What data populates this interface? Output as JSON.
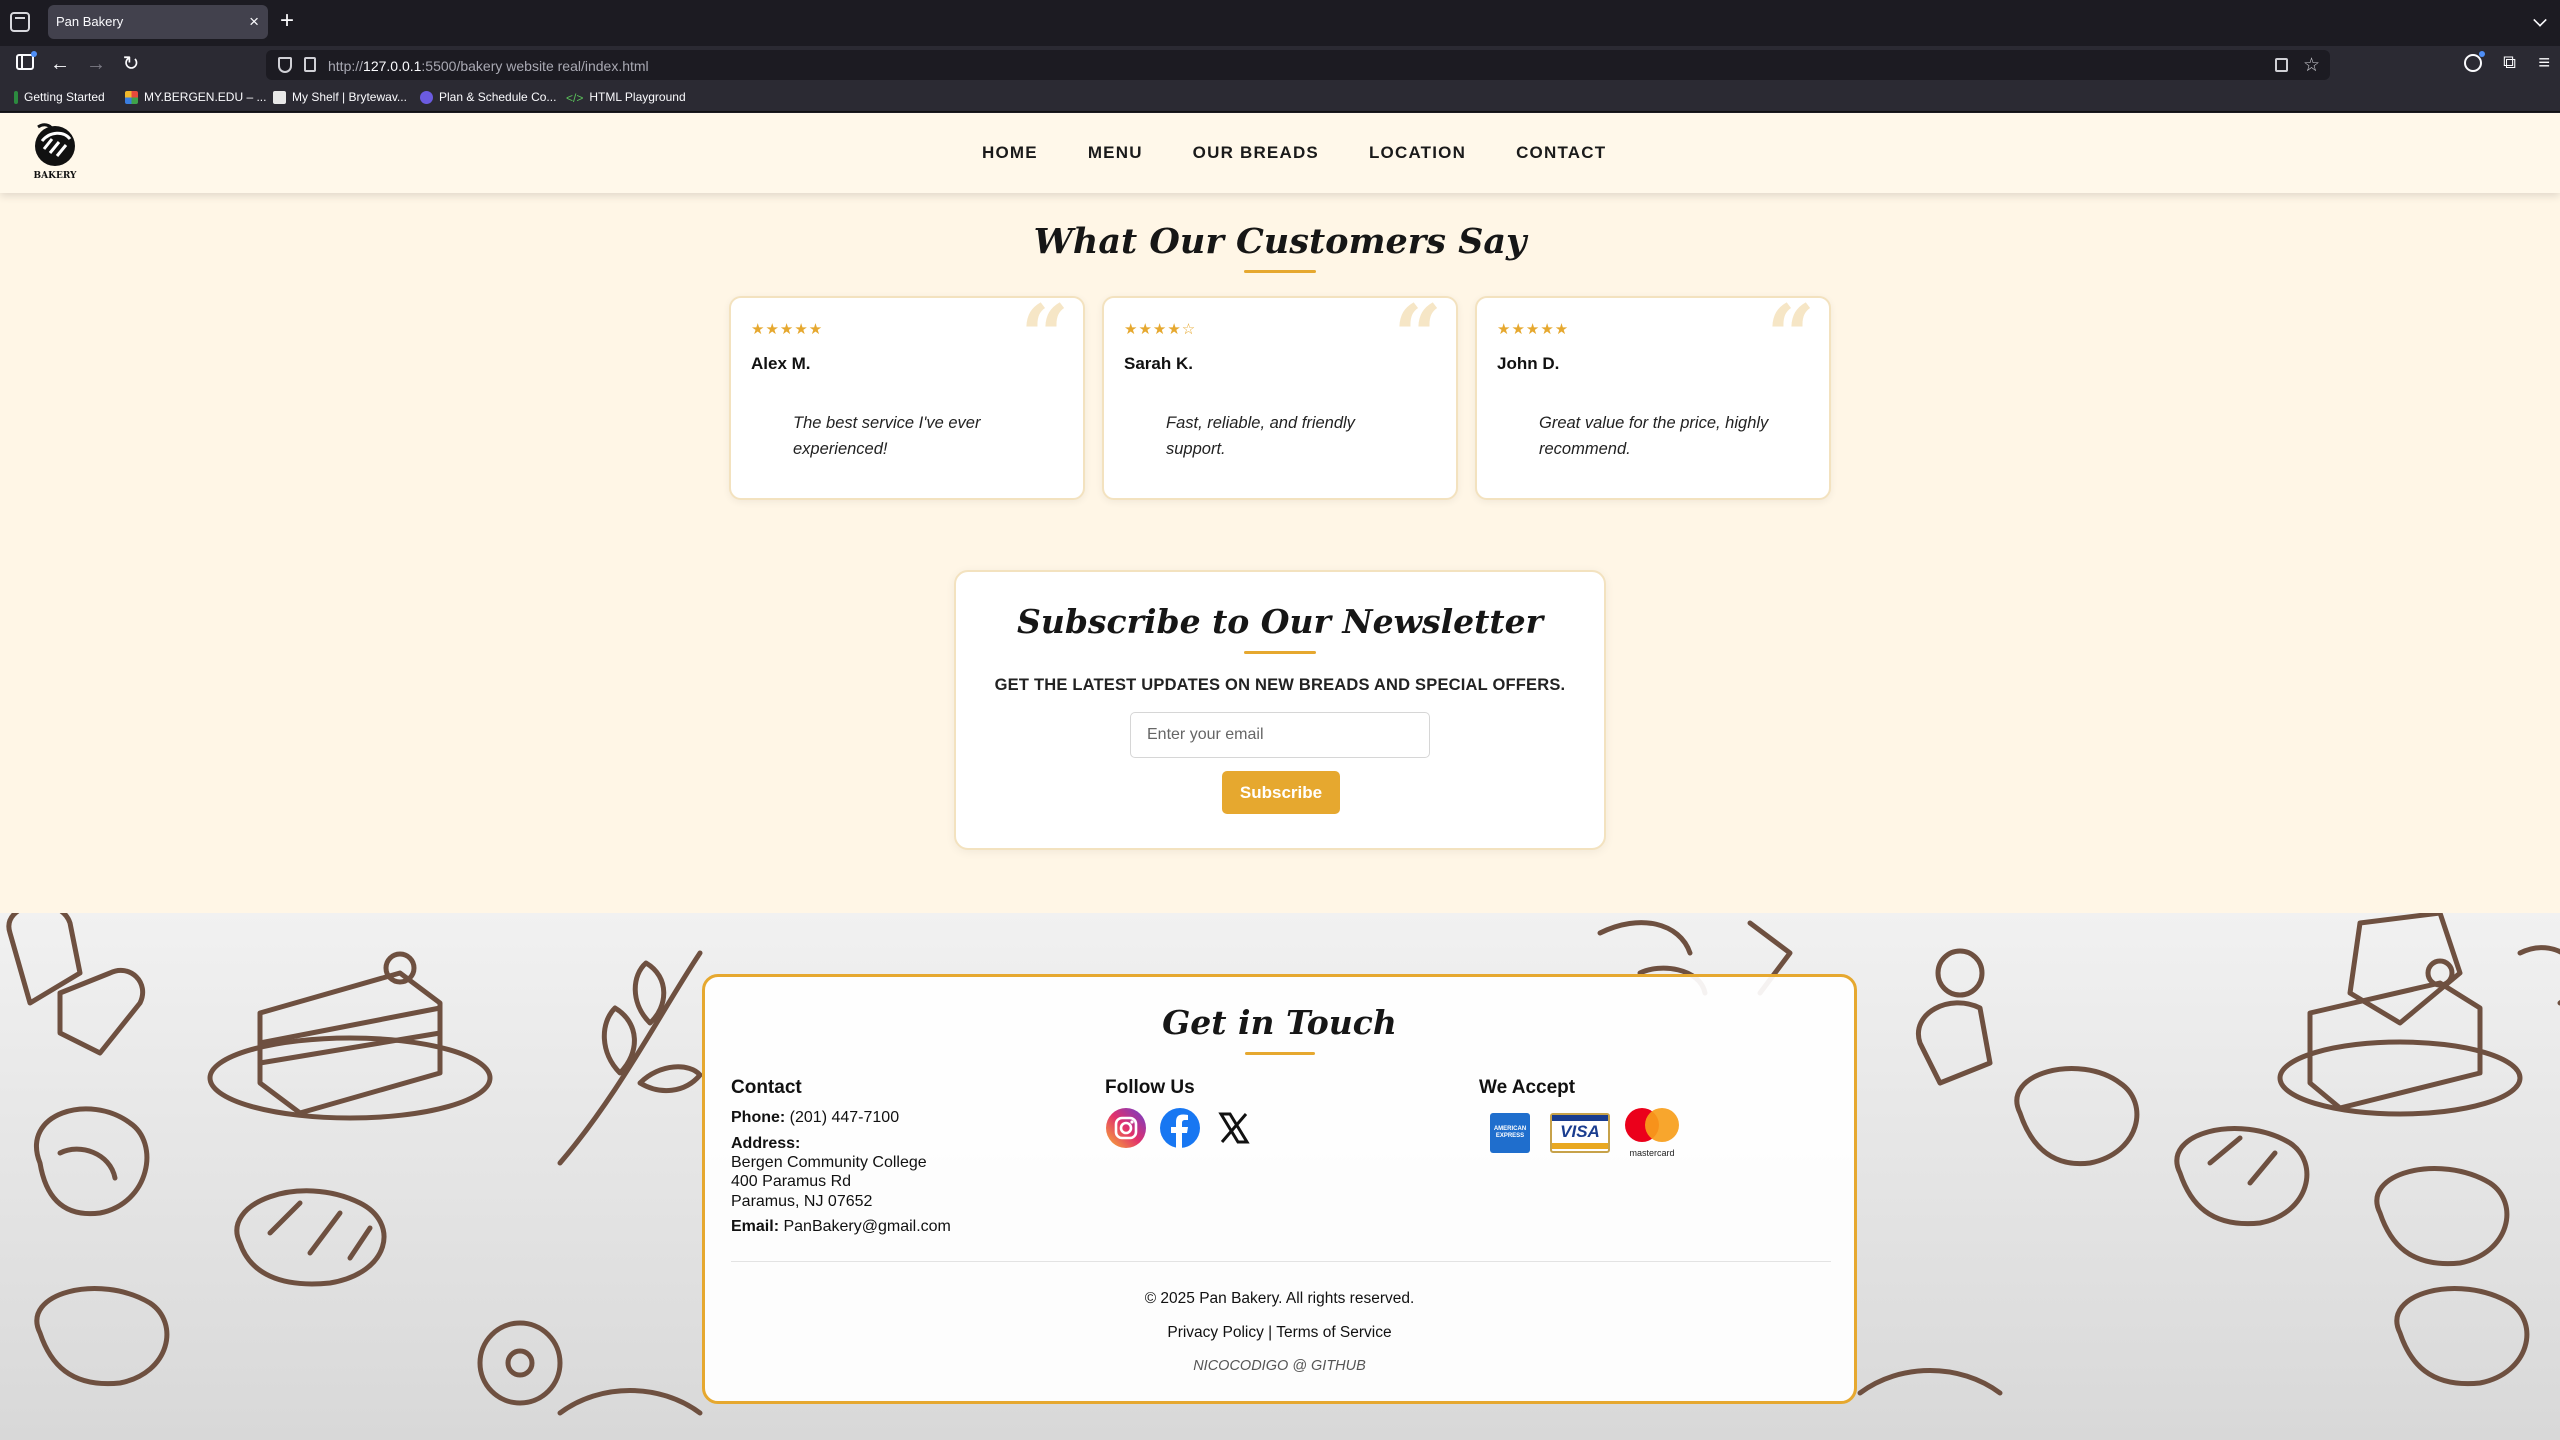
{
  "browser": {
    "tab_title": "Pan Bakery",
    "tab_close": "×",
    "new_tab": "+",
    "url_prefix": "http://",
    "url_host": "127.0.0.1",
    "url_rest": ":5500/bakery website real/index.html",
    "bookmarks": [
      "Getting Started",
      "MY.BERGEN.EDU – ...",
      "My Shelf | Brytewav...",
      "Plan & Schedule Co...",
      "HTML Playground"
    ]
  },
  "header": {
    "logo_text": "BAKERY",
    "nav": [
      "HOME",
      "MENU",
      "OUR BREADS",
      "LOCATION",
      "CONTACT"
    ]
  },
  "testimonials": {
    "title": "What Our Customers Say",
    "reviews": [
      {
        "stars": "★★★★★",
        "rating": 5,
        "name": "Alex M.",
        "text": "The best service I've ever experienced!"
      },
      {
        "stars": "★★★★☆",
        "rating": 4,
        "name": "Sarah K.",
        "text": "Fast, reliable, and friendly support."
      },
      {
        "stars": "★★★★★",
        "rating": 5,
        "name": "John D.",
        "text": "Great value for the price, highly recommend."
      }
    ],
    "quote_glyph": "“"
  },
  "newsletter": {
    "title": "Subscribe to Our Newsletter",
    "subtitle": "GET THE LATEST UPDATES ON NEW BREADS AND SPECIAL OFFERS.",
    "placeholder": "Enter your email",
    "button": "Subscribe"
  },
  "footer": {
    "title": "Get in Touch",
    "contact": {
      "heading": "Contact",
      "phone_label": "Phone:",
      "phone": "(201) 447-7100",
      "address_label": "Address:",
      "address_lines": [
        "Bergen Community College",
        "400 Paramus Rd",
        "Paramus, NJ 07652"
      ],
      "email_label": "Email:",
      "email": "PanBakery@gmail.com"
    },
    "follow": {
      "heading": "Follow Us",
      "icons": [
        "instagram-icon",
        "facebook-icon",
        "x-icon"
      ]
    },
    "accept": {
      "heading": "We Accept",
      "cards": [
        "AMERICAN EXPRESS",
        "VISA",
        "mastercard"
      ]
    },
    "copyright": "© 2025 Pan Bakery. All rights reserved.",
    "privacy": "Privacy Policy",
    "separator": "|",
    "terms": "Terms of Service",
    "credit": "NICOCODIGO @ GITHUB"
  },
  "colors": {
    "accent": "#e6a82f",
    "page_bg": "#fff6e6",
    "chrome_bg": "#1c1b22"
  }
}
